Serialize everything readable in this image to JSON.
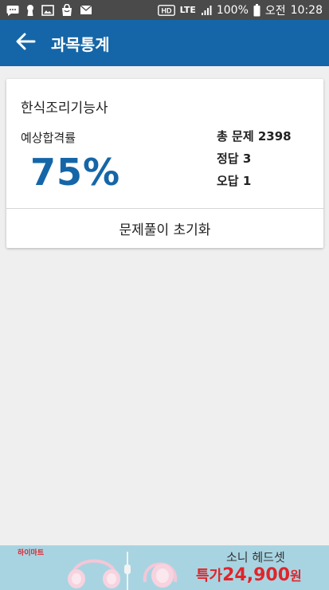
{
  "status_bar": {
    "network_label": "LTE",
    "hd_label": "HD",
    "battery": "100%",
    "ampm": "오전",
    "time": "10:28",
    "icons": [
      "chat-icon",
      "keyhole-icon",
      "image-icon",
      "shopping-bag-icon",
      "mail-icon",
      "hd-icon",
      "signal-icon",
      "battery-icon"
    ]
  },
  "app_bar": {
    "title": "과목통계",
    "back_icon": "arrow-left-icon",
    "color": "#1566a8"
  },
  "stats_card": {
    "subject": "한식조리기능사",
    "pass_rate_label": "예상합격률",
    "pass_rate": "75%",
    "total_label": "총 문제 2398",
    "correct_label": "정답 3",
    "wrong_label": "오답 1",
    "reset_label": "문제풀이 초기화",
    "accent": "#1566a8"
  },
  "ad": {
    "brand": "하이마트",
    "product": "소니 헤드셋",
    "price_label": "특가",
    "price": "24,900",
    "price_unit": "원",
    "color": "#e0252a"
  }
}
